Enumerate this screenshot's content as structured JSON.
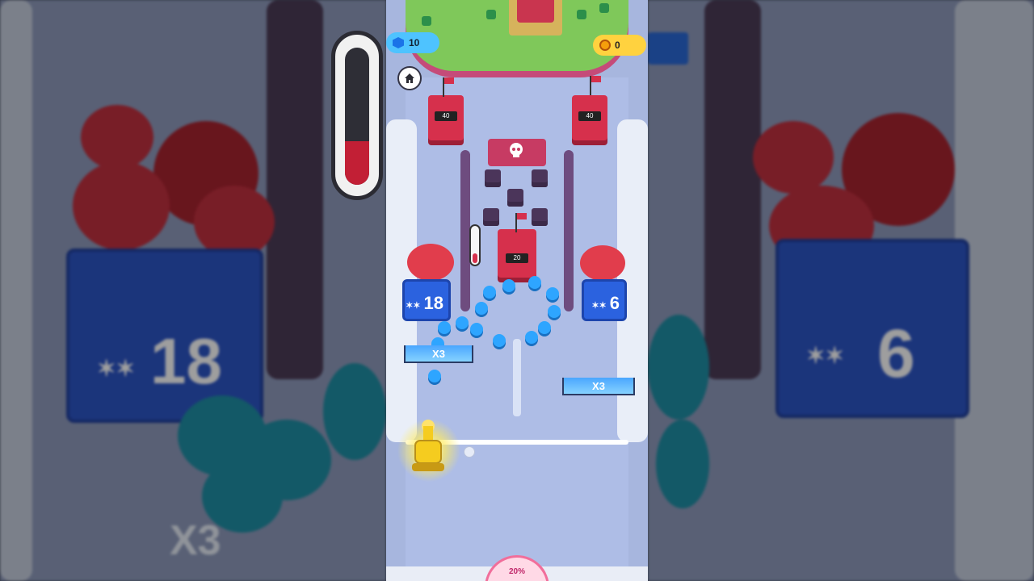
{
  "hud": {
    "gems": "10",
    "coins": "0",
    "progress": "20%",
    "progress_value": 0.2
  },
  "towers": {
    "left_hp": "40",
    "right_hp": "40",
    "center_hp": "20"
  },
  "crates": {
    "left_count": "18",
    "right_count": "6"
  },
  "multipliers": {
    "left": "X3",
    "right": "X3"
  },
  "background": {
    "left_multiplier": "X3",
    "left_count": "18",
    "right_count": "6"
  },
  "icons": {
    "home": "home-icon",
    "gem": "gem-icon",
    "coin": "coin-icon",
    "skull": "skull-icon",
    "people": "people-icon"
  },
  "colors": {
    "enemy": "#d6304c",
    "player": "#2ea5ff",
    "cannon": "#f5cc1f",
    "crate": "#2b62df"
  }
}
